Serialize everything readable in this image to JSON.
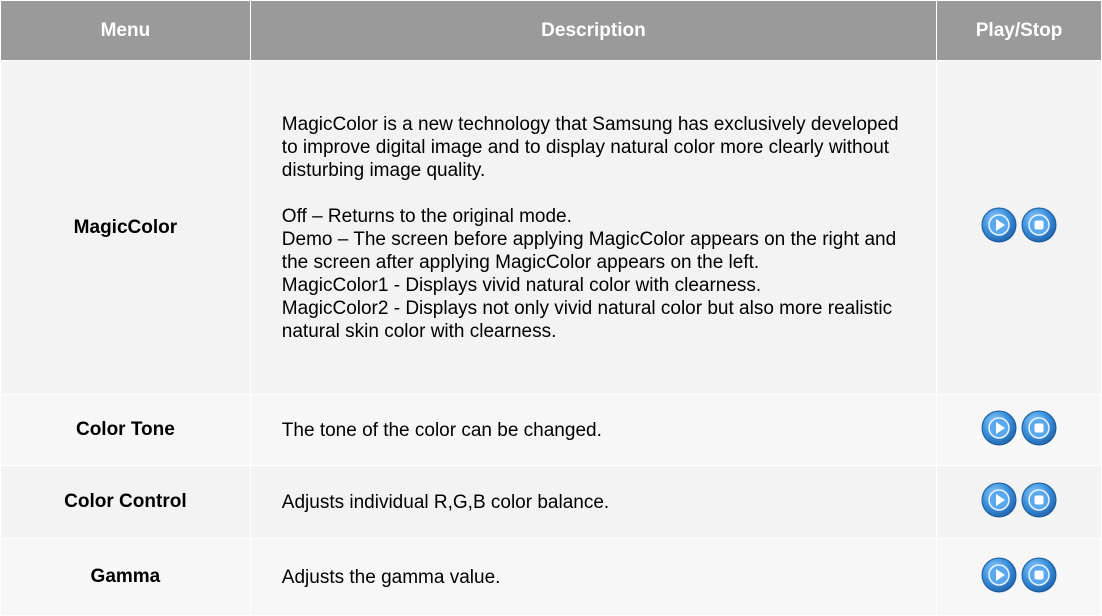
{
  "table": {
    "headers": {
      "menu": "Menu",
      "description": "Description",
      "play_stop": "Play/Stop"
    },
    "rows": [
      {
        "menu": "MagicColor",
        "description_paragraph": "MagicColor is a new technology that Samsung has exclusively developed to improve digital image and to display natural color more clearly without disturbing image quality.",
        "description_lines": [
          "Off – Returns to the original mode.",
          "Demo – The screen before applying MagicColor appears on the right and the screen after applying MagicColor appears on the left.",
          "MagicColor1 - Displays vivid natural color with clearness.",
          "MagicColor2 - Displays not only vivid natural color but also more realistic natural skin color with clearness."
        ]
      },
      {
        "menu": "Color Tone",
        "description": "The tone of the color can be changed."
      },
      {
        "menu": "Color Control",
        "description": "Adjusts individual R,G,B color balance."
      },
      {
        "menu": "Gamma",
        "description": "Adjusts the gamma value."
      }
    ]
  },
  "icons": {
    "play": "play-icon",
    "stop": "stop-icon"
  },
  "colors": {
    "header_bg": "#9a9a9a",
    "header_text": "#ffffff",
    "button_blue": "#2f86d6",
    "row_bg": "#f3f3f3"
  }
}
